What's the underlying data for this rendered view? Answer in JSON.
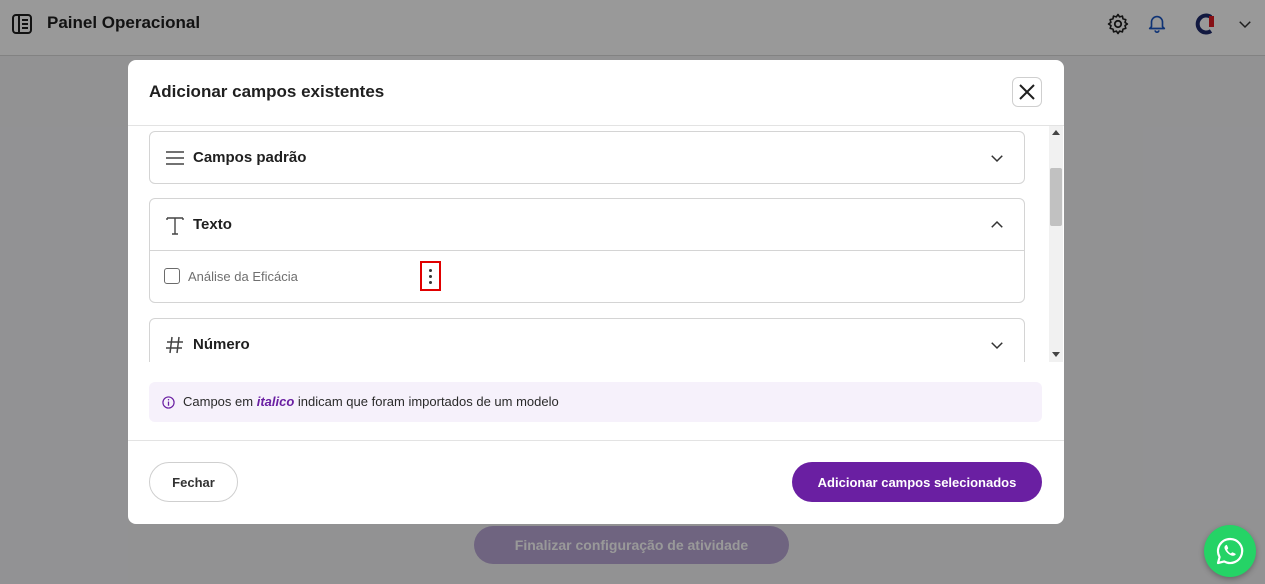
{
  "app": {
    "title": "Painel Operacional"
  },
  "background": {
    "finish_button_label": "Finalizar configuração de atividade"
  },
  "modal": {
    "title": "Adicionar campos existentes",
    "sections": [
      {
        "label": "Campos padrão",
        "icon": "lines-icon",
        "expanded": false
      },
      {
        "label": "Texto",
        "icon": "text-icon",
        "expanded": true,
        "fields": [
          {
            "label": "Análise da Eficácia",
            "checked": false
          }
        ]
      },
      {
        "label": "Número",
        "icon": "hash-icon",
        "expanded": false
      }
    ],
    "info": {
      "before": "Campos em ",
      "emphasis": "italico",
      "after": " indicam que foram importados de um modelo"
    },
    "footer": {
      "close_label": "Fechar",
      "add_label": "Adicionar campos selecionados"
    }
  },
  "colors": {
    "accent": "#6a1fa2",
    "info_bg": "#f6f1fb",
    "whatsapp": "#25d366",
    "highlight": "#e00000"
  }
}
